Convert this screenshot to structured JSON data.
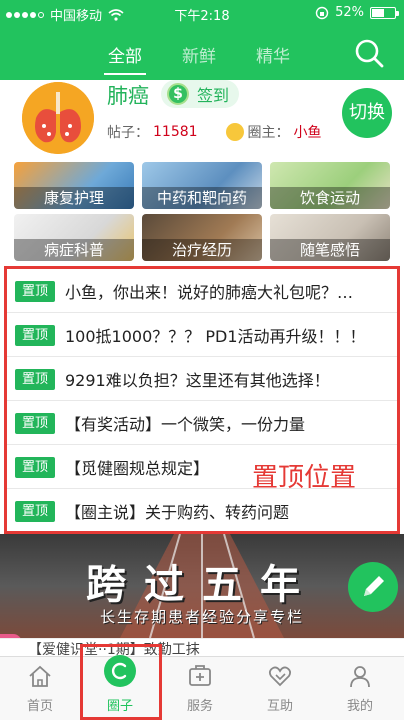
{
  "status_bar": {
    "carrier": "中国移动",
    "time": "下午2:18",
    "battery": "52%"
  },
  "tabs": [
    {
      "label": "全部",
      "active": true
    },
    {
      "label": "新鲜",
      "active": false
    },
    {
      "label": "精华",
      "active": false
    }
  ],
  "forum": {
    "name": "肺癌",
    "checkin_label": "签到",
    "checkin_icon": "$",
    "posts_label": "帖子：",
    "posts_count": "11581",
    "moderator_label": "圈主：",
    "moderator": "小鱼",
    "switch_label": "切换"
  },
  "categories": [
    {
      "label": "康复护理"
    },
    {
      "label": "中药和靶向药"
    },
    {
      "label": "饮食运动"
    },
    {
      "label": "病症科普"
    },
    {
      "label": "治疗经历"
    },
    {
      "label": "随笔感悟"
    }
  ],
  "pinned": {
    "badge": "置顶",
    "annotation": "置顶位置",
    "items": [
      {
        "title": "小鱼，你出来！说好的肺癌大礼包呢？…"
      },
      {
        "title": "100抵1000？？？ PD1活动再升级！！！"
      },
      {
        "title": "9291难以负担？这里还有其他选择！"
      },
      {
        "title": "【有奖活动】一个微笑，一份力量"
      },
      {
        "title": "【觅健圈规总规定】"
      },
      {
        "title": "【圈主说】关于购药、转药问题"
      }
    ]
  },
  "banner": {
    "headline": "跨过五年",
    "subline": "长生存期患者经验分享专栏"
  },
  "next_post_partial": "【爱健识堂··1期】致勤工抹",
  "nav": [
    {
      "label": "首页",
      "icon": "home-icon",
      "active": false
    },
    {
      "label": "圈子",
      "icon": "circle-icon",
      "active": true
    },
    {
      "label": "服务",
      "icon": "service-icon",
      "active": false
    },
    {
      "label": "互助",
      "icon": "handshake-icon",
      "active": false
    },
    {
      "label": "我的",
      "icon": "user-icon",
      "active": false
    }
  ],
  "colors": {
    "brand_green": "#22c35e",
    "annotation_red": "#e53935",
    "count_red": "#d0021b"
  }
}
